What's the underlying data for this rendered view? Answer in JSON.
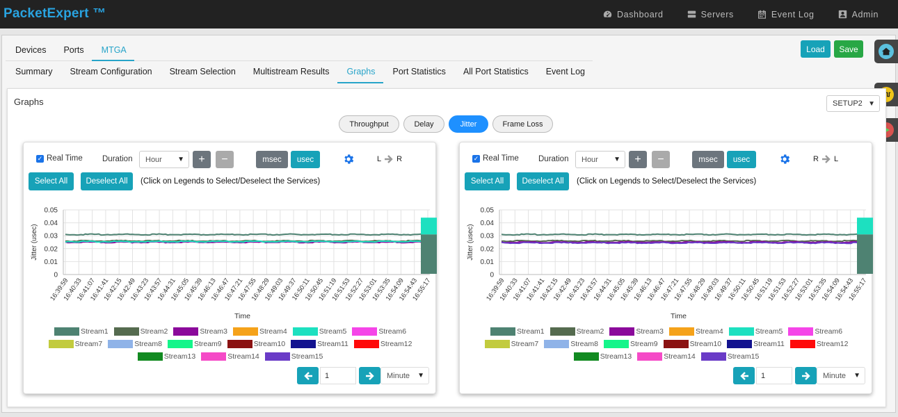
{
  "app": {
    "brand": "PacketExpert ™"
  },
  "nav": [
    {
      "label": "Dashboard",
      "icon": "dashboard-icon"
    },
    {
      "label": "Servers",
      "icon": "server-icon"
    },
    {
      "label": "Event Log",
      "icon": "calendar-icon"
    },
    {
      "label": "Admin",
      "icon": "user-icon"
    }
  ],
  "tabs_primary": [
    {
      "label": "Devices",
      "active": false
    },
    {
      "label": "Ports",
      "active": false
    },
    {
      "label": "MTGA",
      "active": true
    }
  ],
  "tabs_secondary": [
    {
      "label": "Summary",
      "active": false
    },
    {
      "label": "Stream Configuration",
      "active": false
    },
    {
      "label": "Stream Selection",
      "active": false
    },
    {
      "label": "Multistream Results",
      "active": false
    },
    {
      "label": "Graphs",
      "active": true
    },
    {
      "label": "Port Statistics",
      "active": false
    },
    {
      "label": "All Port Statistics",
      "active": false
    },
    {
      "label": "Event Log",
      "active": false
    }
  ],
  "toolbar": {
    "load_label": "Load",
    "save_label": "Save"
  },
  "graphs": {
    "title": "Graphs",
    "setup_value": "SETUP2",
    "metric_tabs": [
      {
        "label": "Throughput",
        "active": false
      },
      {
        "label": "Delay",
        "active": false
      },
      {
        "label": "Jitter",
        "active": true
      },
      {
        "label": "Frame Loss",
        "active": false
      }
    ]
  },
  "controls": {
    "realtime_label": "Real Time",
    "realtime_checked": true,
    "duration_label": "Duration",
    "duration_value": "Hour",
    "msec_label": "msec",
    "usec_label": "usec",
    "select_all_label": "Select All",
    "deselect_all_label": "Deselect All",
    "hint_text": "(Click on Legends to Select/Deselect the Services)",
    "page_value": "1",
    "page_unit": "Minute"
  },
  "direction_left": {
    "from": "L",
    "to": "R"
  },
  "direction_right": {
    "from": "R",
    "to": "L"
  },
  "legend": [
    {
      "name": "Stream1",
      "color": "#4e8272"
    },
    {
      "name": "Stream2",
      "color": "#556b4f"
    },
    {
      "name": "Stream3",
      "color": "#8b0a9b"
    },
    {
      "name": "Stream4",
      "color": "#f5a21a"
    },
    {
      "name": "Stream5",
      "color": "#1de0c0"
    },
    {
      "name": "Stream6",
      "color": "#f545e8"
    },
    {
      "name": "Stream7",
      "color": "#c2cb3e"
    },
    {
      "name": "Stream8",
      "color": "#8fb3e8"
    },
    {
      "name": "Stream9",
      "color": "#14f58a"
    },
    {
      "name": "Stream10",
      "color": "#8b1212"
    },
    {
      "name": "Stream11",
      "color": "#13138f"
    },
    {
      "name": "Stream12",
      "color": "#ff0a0a"
    },
    {
      "name": "Stream13",
      "color": "#128a21"
    },
    {
      "name": "Stream14",
      "color": "#f54ac7"
    },
    {
      "name": "Stream15",
      "color": "#6a3bc7"
    }
  ],
  "chart_data": [
    {
      "type": "line",
      "direction": "L → R",
      "xlabel": "Time",
      "ylabel": "Jitter (usec)",
      "ylim": [
        0,
        0.05
      ],
      "yticks": [
        "0",
        "0.01",
        "0.02",
        "0.03",
        "0.04",
        "0.05"
      ],
      "x_ticks": [
        "16:39:59",
        "16:40:33",
        "16:41:07",
        "16:41:41",
        "16:42:15",
        "16:42:49",
        "16:43:23",
        "16:43:57",
        "16:44:31",
        "16:45:05",
        "16:45:39",
        "16:46:13",
        "16:46:47",
        "16:47:21",
        "16:47:55",
        "16:48:29",
        "16:49:03",
        "16:49:37",
        "16:50:11",
        "16:50:45",
        "16:51:19",
        "16:51:53",
        "16:52:27",
        "16:53:01",
        "16:53:35",
        "16:54:09",
        "16:54:43",
        "16:55:17"
      ],
      "series": [
        {
          "name": "Stream1",
          "level": 0.031
        },
        {
          "name": "Stream2",
          "level": 0.026
        },
        {
          "name": "Stream3",
          "level": 0.025
        },
        {
          "name": "Stream5",
          "level": 0.0255
        }
      ],
      "spike": {
        "x": "16:55:17",
        "max": 0.044
      }
    },
    {
      "type": "line",
      "direction": "R → L",
      "xlabel": "Time",
      "ylabel": "Jitter (usec)",
      "ylim": [
        0,
        0.05
      ],
      "yticks": [
        "0",
        "0.01",
        "0.02",
        "0.03",
        "0.04",
        "0.05"
      ],
      "x_ticks": [
        "16:39:59",
        "16:40:33",
        "16:41:07",
        "16:41:41",
        "16:42:15",
        "16:42:49",
        "16:43:23",
        "16:43:57",
        "16:44:31",
        "16:45:05",
        "16:45:39",
        "16:46:13",
        "16:46:47",
        "16:47:21",
        "16:47:55",
        "16:48:29",
        "16:49:03",
        "16:49:37",
        "16:50:11",
        "16:50:45",
        "16:51:19",
        "16:51:53",
        "16:52:27",
        "16:53:01",
        "16:53:35",
        "16:54:09",
        "16:54:43",
        "16:55:17"
      ],
      "series": [
        {
          "name": "Stream1",
          "level": 0.031
        },
        {
          "name": "Stream2",
          "level": 0.026
        },
        {
          "name": "Stream3",
          "level": 0.025
        },
        {
          "name": "Stream15",
          "level": 0.0245
        }
      ],
      "spike": {
        "x": "16:55:17",
        "max": 0.044
      }
    }
  ]
}
